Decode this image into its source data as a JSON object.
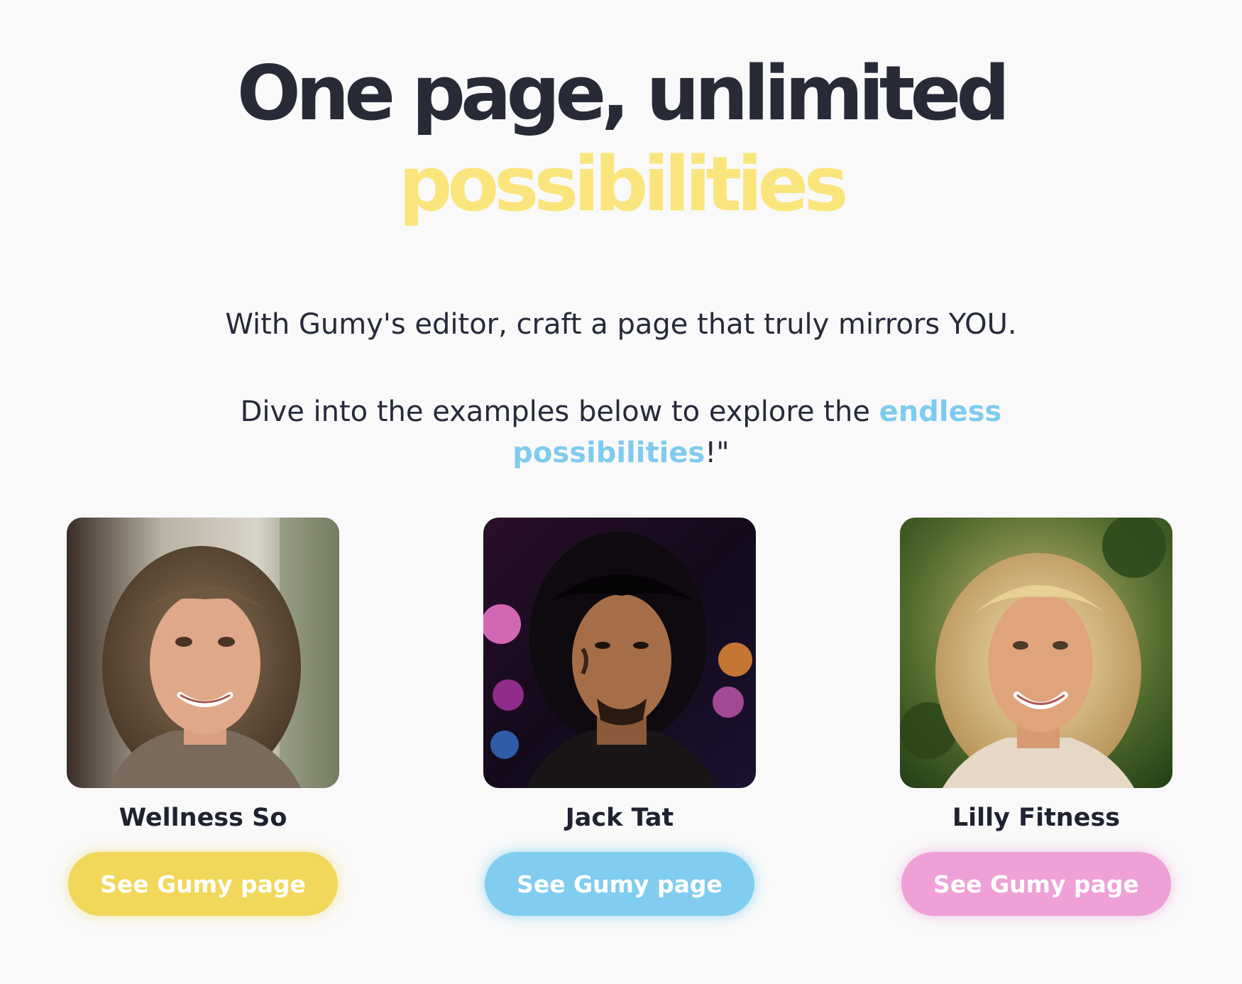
{
  "headline": {
    "line1": "One page, unlimited",
    "line2": "possibilities"
  },
  "subtext": {
    "line1": "With Gumy's editor, craft a page that truly mirrors YOU.",
    "line2_prefix": "Dive into the examples below to explore the ",
    "line2_link": "endless possibilities",
    "line2_suffix": "!\""
  },
  "colors": {
    "accent_yellow": "#fae57c",
    "accent_blue": "#7fcbef",
    "accent_pink": "#efa0d6",
    "text_dark": "#292a38"
  },
  "examples": [
    {
      "name": "Wellness So",
      "button_label": "See Gumy page",
      "button_color": "#f1d85a"
    },
    {
      "name": "Jack Tat",
      "button_label": "See Gumy page",
      "button_color": "#80cdef"
    },
    {
      "name": "Lilly Fitness",
      "button_label": "See Gumy page",
      "button_color": "#efa0d6"
    }
  ]
}
